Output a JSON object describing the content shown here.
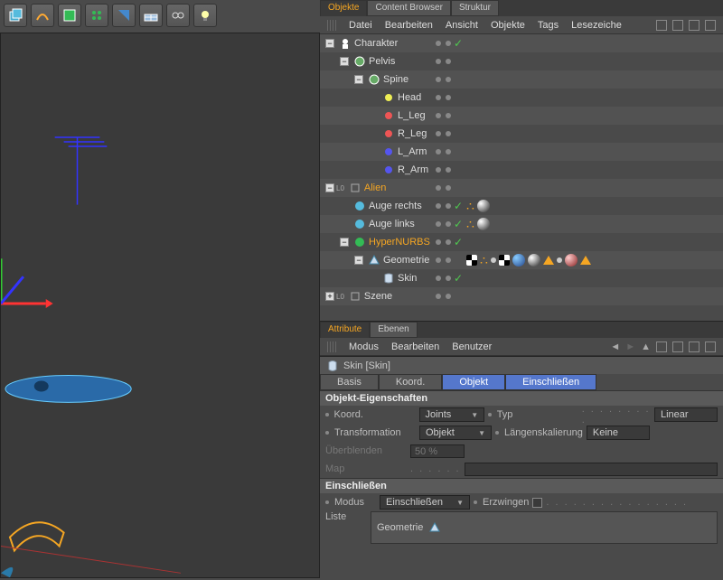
{
  "toolbar": {
    "icons": [
      "cube",
      "spline",
      "nurbs",
      "array",
      "boole",
      "floor",
      "eyes",
      "light"
    ]
  },
  "objPanel": {
    "tabs": [
      {
        "label": "Objekte",
        "active": true
      },
      {
        "label": "Content Browser"
      },
      {
        "label": "Struktur"
      }
    ],
    "menu": [
      "Datei",
      "Bearbeiten",
      "Ansicht",
      "Objekte",
      "Tags",
      "Lesezeiche"
    ],
    "tree": [
      {
        "ind": 0,
        "exp": "-",
        "icon": "char",
        "name": "Charakter",
        "dots": true,
        "chk": true
      },
      {
        "ind": 1,
        "exp": "-",
        "icon": "joint",
        "name": "Pelvis",
        "dots": true
      },
      {
        "ind": 2,
        "exp": "-",
        "icon": "joint",
        "name": "Spine",
        "dots": true
      },
      {
        "ind": 3,
        "icon": "jy",
        "name": "Head",
        "dots": true
      },
      {
        "ind": 3,
        "icon": "jr",
        "name": "L_Leg",
        "dots": true
      },
      {
        "ind": 3,
        "icon": "jr",
        "name": "R_Leg",
        "dots": true
      },
      {
        "ind": 3,
        "icon": "jb",
        "name": "L_Arm",
        "dots": true
      },
      {
        "ind": 3,
        "icon": "jb",
        "name": "R_Arm",
        "dots": true
      },
      {
        "ind": 0,
        "exp": "-",
        "pre": "L0",
        "icon": "null",
        "name": "Alien",
        "dots": true,
        "nameColor": "#f5a623"
      },
      {
        "ind": 1,
        "icon": "sphere",
        "name": "Auge rechts",
        "dots": true,
        "chk": true,
        "mats": [
          "dots",
          "ball"
        ]
      },
      {
        "ind": 1,
        "icon": "sphere",
        "name": "Auge links",
        "dots": true,
        "chk": true,
        "mats": [
          "dots",
          "ball"
        ]
      },
      {
        "ind": 1,
        "exp": "-",
        "icon": "hn",
        "name": "HyperNURBS",
        "dots": true,
        "chk": true,
        "nameColor": "#f5a623"
      },
      {
        "ind": 2,
        "exp": "-",
        "icon": "poly",
        "name": "Geometrie",
        "dots": true,
        "mats": [
          "chk",
          "dots",
          "dot",
          "chk",
          "ball2",
          "ball",
          "tri",
          "dot",
          "ballr",
          "tri"
        ]
      },
      {
        "ind": 3,
        "icon": "skin",
        "name": "Skin",
        "dots": true,
        "chk": true
      },
      {
        "ind": 0,
        "exp": "+",
        "pre": "L0",
        "icon": "null",
        "name": "Szene",
        "dots": true
      }
    ]
  },
  "attr": {
    "tabs": [
      {
        "label": "Attribute",
        "active": true
      },
      {
        "label": "Ebenen"
      }
    ],
    "menu": [
      "Modus",
      "Bearbeiten",
      "Benutzer"
    ],
    "header": "Skin [Skin]",
    "btabs": [
      {
        "label": "Basis"
      },
      {
        "label": "Koord."
      },
      {
        "label": "Objekt",
        "active": true
      },
      {
        "label": "Einschließen",
        "hl": true
      }
    ],
    "sec1": "Objekt-Eigenschaften",
    "koord": {
      "label": "Koord.",
      "value": "Joints"
    },
    "typ": {
      "label": "Typ",
      "value": "Linear"
    },
    "transf": {
      "label": "Transformation",
      "value": "Objekt"
    },
    "lenscal": {
      "label": "Längenskalierung",
      "value": "Keine"
    },
    "blend": {
      "label": "Überblenden",
      "value": "50 %"
    },
    "map": {
      "label": "Map"
    },
    "sec2": "Einschließen",
    "modus": {
      "label": "Modus",
      "value": "Einschließen"
    },
    "erzw": {
      "label": "Erzwingen"
    },
    "liste": {
      "label": "Liste",
      "value": "Geometrie"
    }
  }
}
